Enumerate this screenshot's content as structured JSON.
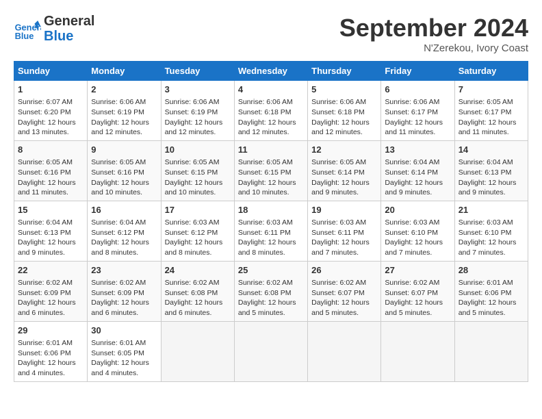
{
  "header": {
    "logo_line1": "General",
    "logo_line2": "Blue",
    "month": "September 2024",
    "location": "N'Zerekou, Ivory Coast"
  },
  "weekdays": [
    "Sunday",
    "Monday",
    "Tuesday",
    "Wednesday",
    "Thursday",
    "Friday",
    "Saturday"
  ],
  "weeks": [
    [
      {
        "day": "1",
        "lines": [
          "Sunrise: 6:07 AM",
          "Sunset: 6:20 PM",
          "Daylight: 12 hours",
          "and 13 minutes."
        ]
      },
      {
        "day": "2",
        "lines": [
          "Sunrise: 6:06 AM",
          "Sunset: 6:19 PM",
          "Daylight: 12 hours",
          "and 12 minutes."
        ]
      },
      {
        "day": "3",
        "lines": [
          "Sunrise: 6:06 AM",
          "Sunset: 6:19 PM",
          "Daylight: 12 hours",
          "and 12 minutes."
        ]
      },
      {
        "day": "4",
        "lines": [
          "Sunrise: 6:06 AM",
          "Sunset: 6:18 PM",
          "Daylight: 12 hours",
          "and 12 minutes."
        ]
      },
      {
        "day": "5",
        "lines": [
          "Sunrise: 6:06 AM",
          "Sunset: 6:18 PM",
          "Daylight: 12 hours",
          "and 12 minutes."
        ]
      },
      {
        "day": "6",
        "lines": [
          "Sunrise: 6:06 AM",
          "Sunset: 6:17 PM",
          "Daylight: 12 hours",
          "and 11 minutes."
        ]
      },
      {
        "day": "7",
        "lines": [
          "Sunrise: 6:05 AM",
          "Sunset: 6:17 PM",
          "Daylight: 12 hours",
          "and 11 minutes."
        ]
      }
    ],
    [
      {
        "day": "8",
        "lines": [
          "Sunrise: 6:05 AM",
          "Sunset: 6:16 PM",
          "Daylight: 12 hours",
          "and 11 minutes."
        ]
      },
      {
        "day": "9",
        "lines": [
          "Sunrise: 6:05 AM",
          "Sunset: 6:16 PM",
          "Daylight: 12 hours",
          "and 10 minutes."
        ]
      },
      {
        "day": "10",
        "lines": [
          "Sunrise: 6:05 AM",
          "Sunset: 6:15 PM",
          "Daylight: 12 hours",
          "and 10 minutes."
        ]
      },
      {
        "day": "11",
        "lines": [
          "Sunrise: 6:05 AM",
          "Sunset: 6:15 PM",
          "Daylight: 12 hours",
          "and 10 minutes."
        ]
      },
      {
        "day": "12",
        "lines": [
          "Sunrise: 6:05 AM",
          "Sunset: 6:14 PM",
          "Daylight: 12 hours",
          "and 9 minutes."
        ]
      },
      {
        "day": "13",
        "lines": [
          "Sunrise: 6:04 AM",
          "Sunset: 6:14 PM",
          "Daylight: 12 hours",
          "and 9 minutes."
        ]
      },
      {
        "day": "14",
        "lines": [
          "Sunrise: 6:04 AM",
          "Sunset: 6:13 PM",
          "Daylight: 12 hours",
          "and 9 minutes."
        ]
      }
    ],
    [
      {
        "day": "15",
        "lines": [
          "Sunrise: 6:04 AM",
          "Sunset: 6:13 PM",
          "Daylight: 12 hours",
          "and 9 minutes."
        ]
      },
      {
        "day": "16",
        "lines": [
          "Sunrise: 6:04 AM",
          "Sunset: 6:12 PM",
          "Daylight: 12 hours",
          "and 8 minutes."
        ]
      },
      {
        "day": "17",
        "lines": [
          "Sunrise: 6:03 AM",
          "Sunset: 6:12 PM",
          "Daylight: 12 hours",
          "and 8 minutes."
        ]
      },
      {
        "day": "18",
        "lines": [
          "Sunrise: 6:03 AM",
          "Sunset: 6:11 PM",
          "Daylight: 12 hours",
          "and 8 minutes."
        ]
      },
      {
        "day": "19",
        "lines": [
          "Sunrise: 6:03 AM",
          "Sunset: 6:11 PM",
          "Daylight: 12 hours",
          "and 7 minutes."
        ]
      },
      {
        "day": "20",
        "lines": [
          "Sunrise: 6:03 AM",
          "Sunset: 6:10 PM",
          "Daylight: 12 hours",
          "and 7 minutes."
        ]
      },
      {
        "day": "21",
        "lines": [
          "Sunrise: 6:03 AM",
          "Sunset: 6:10 PM",
          "Daylight: 12 hours",
          "and 7 minutes."
        ]
      }
    ],
    [
      {
        "day": "22",
        "lines": [
          "Sunrise: 6:02 AM",
          "Sunset: 6:09 PM",
          "Daylight: 12 hours",
          "and 6 minutes."
        ]
      },
      {
        "day": "23",
        "lines": [
          "Sunrise: 6:02 AM",
          "Sunset: 6:09 PM",
          "Daylight: 12 hours",
          "and 6 minutes."
        ]
      },
      {
        "day": "24",
        "lines": [
          "Sunrise: 6:02 AM",
          "Sunset: 6:08 PM",
          "Daylight: 12 hours",
          "and 6 minutes."
        ]
      },
      {
        "day": "25",
        "lines": [
          "Sunrise: 6:02 AM",
          "Sunset: 6:08 PM",
          "Daylight: 12 hours",
          "and 5 minutes."
        ]
      },
      {
        "day": "26",
        "lines": [
          "Sunrise: 6:02 AM",
          "Sunset: 6:07 PM",
          "Daylight: 12 hours",
          "and 5 minutes."
        ]
      },
      {
        "day": "27",
        "lines": [
          "Sunrise: 6:02 AM",
          "Sunset: 6:07 PM",
          "Daylight: 12 hours",
          "and 5 minutes."
        ]
      },
      {
        "day": "28",
        "lines": [
          "Sunrise: 6:01 AM",
          "Sunset: 6:06 PM",
          "Daylight: 12 hours",
          "and 5 minutes."
        ]
      }
    ],
    [
      {
        "day": "29",
        "lines": [
          "Sunrise: 6:01 AM",
          "Sunset: 6:06 PM",
          "Daylight: 12 hours",
          "and 4 minutes."
        ]
      },
      {
        "day": "30",
        "lines": [
          "Sunrise: 6:01 AM",
          "Sunset: 6:05 PM",
          "Daylight: 12 hours",
          "and 4 minutes."
        ]
      },
      null,
      null,
      null,
      null,
      null
    ]
  ]
}
